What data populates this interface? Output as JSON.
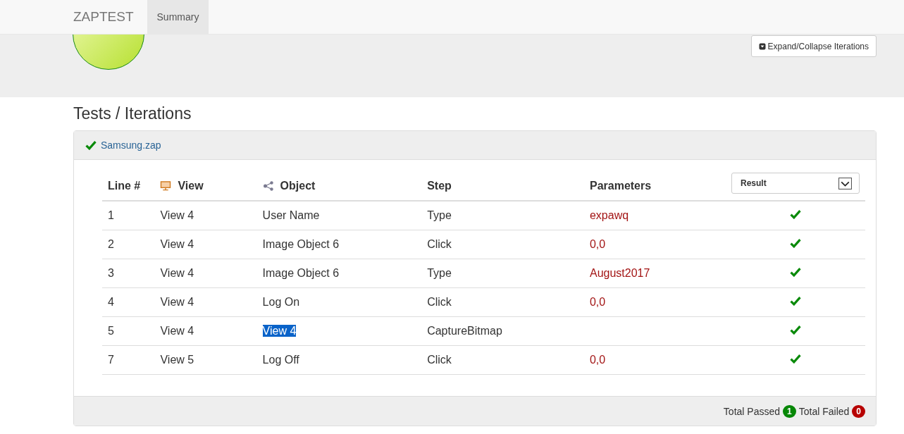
{
  "navbar": {
    "brand": "ZAPTEST",
    "tabs": [
      {
        "label": "Summary",
        "selected": true
      }
    ]
  },
  "summary": {
    "expand_button": "Expand/Collapse Iterations"
  },
  "section_title": "Tests / Iterations",
  "iteration": {
    "name": "Samsung.zap",
    "passed": true,
    "columns": [
      {
        "label": "Line #"
      },
      {
        "label": "View"
      },
      {
        "label": "Object"
      },
      {
        "label": "Step"
      },
      {
        "label": "Parameters"
      }
    ],
    "result_filter": {
      "value": "Result"
    },
    "rows": [
      {
        "line": "1",
        "view": "View 4",
        "object": "User Name",
        "step": "Type",
        "parameters": "expawq",
        "passed": true,
        "highlighted": false
      },
      {
        "line": "2",
        "view": "View 4",
        "object": "Image Object 6",
        "step": "Click",
        "parameters": "0,0",
        "passed": true,
        "highlighted": false
      },
      {
        "line": "3",
        "view": "View 4",
        "object": "Image Object 6",
        "step": "Type",
        "parameters": "August2017",
        "passed": true,
        "highlighted": false
      },
      {
        "line": "4",
        "view": "View 4",
        "object": "Log On",
        "step": "Click",
        "parameters": "0,0",
        "passed": true,
        "highlighted": false
      },
      {
        "line": "5",
        "view": "View 4",
        "object": "View 4",
        "step": "CaptureBitmap",
        "passed": true,
        "highlighted": true
      },
      {
        "line": "7",
        "view": "View 5",
        "object": "Log Off",
        "step": "Click",
        "parameters": "0,0",
        "passed": true,
        "highlighted": false
      }
    ],
    "footer": {
      "passed_label": "Total Passed",
      "passed_count": "1",
      "failed_label": "Total Failed",
      "failed_count": "0"
    }
  }
}
